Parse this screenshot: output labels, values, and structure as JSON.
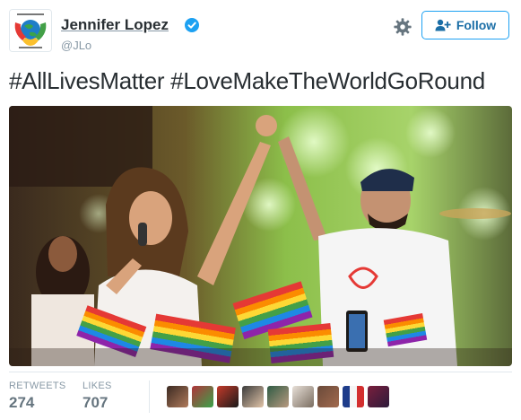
{
  "user": {
    "display_name": "Jennifer Lopez",
    "handle": "@JLo",
    "verified": true,
    "avatar_icon": "love-globe-logo"
  },
  "actions": {
    "follow_label": "Follow",
    "settings_icon": "gear-icon"
  },
  "tweet": {
    "text": "#AllLivesMatter #LoveMakeTheWorldGoRound"
  },
  "stats": {
    "retweets_label": "RETWEETS",
    "retweets_value": "274",
    "likes_label": "LIKES",
    "likes_value": "707"
  },
  "likers_count": 10,
  "colors": {
    "link_blue": "#1da1f2",
    "follow_text": "#1b6ea6",
    "muted": "#8899a6",
    "text": "#292f33"
  }
}
